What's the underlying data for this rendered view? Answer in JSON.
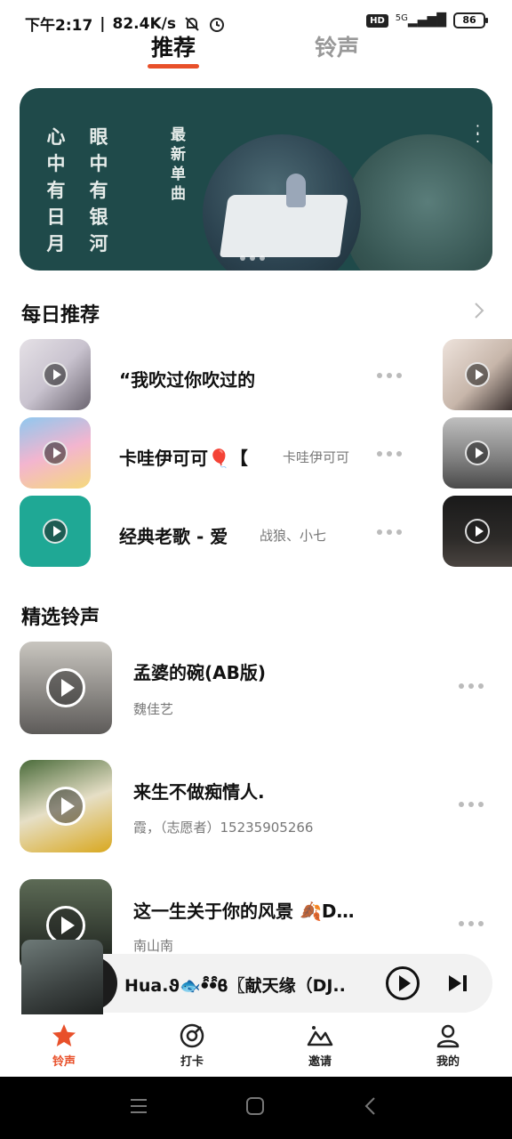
{
  "status_bar": {
    "time": "下午2:17",
    "speed": "82.4K/s",
    "network": "5G",
    "hd_badge": "HD",
    "battery": "86"
  },
  "top_tabs": [
    {
      "label": "推荐",
      "active": true
    },
    {
      "label": "铃声",
      "active": false
    }
  ],
  "banner": {
    "calligraphy_left": [
      "心",
      "中",
      "有",
      "日",
      "月"
    ],
    "calligraphy_right": [
      "眼",
      "中",
      "有",
      "银",
      "河"
    ],
    "vertical_text": [
      "最",
      "新",
      "单",
      "曲"
    ]
  },
  "daily": {
    "title": "每日推荐",
    "items": [
      {
        "title": "“我吹过你吹过的",
        "subtitle": ""
      },
      {
        "title": "卡哇伊可可🎈【",
        "subtitle": "卡哇伊可可"
      },
      {
        "title": "经典老歌 - 爱",
        "subtitle": "战狼、小七"
      }
    ]
  },
  "ringtones": {
    "title": "精选铃声",
    "items": [
      {
        "title": "孟婆的碗(AB版)",
        "artist": "魏佳艺"
      },
      {
        "title": "来生不做痴情人.",
        "artist": "霞，（志愿者）15235905266"
      },
      {
        "title": "这一生关于你的风景 🍂D…",
        "artist": "南山南"
      }
    ]
  },
  "player": {
    "title": "Hua.ϑ🐟ꔷ̑̑ꔷ̑̑ϐ〖献天缘（DJ.."
  },
  "bottom_nav": [
    {
      "label": "铃声",
      "icon": "star-icon",
      "active": true
    },
    {
      "label": "打卡",
      "icon": "checkin-icon",
      "active": false
    },
    {
      "label": "邀请",
      "icon": "invite-icon",
      "active": false
    },
    {
      "label": "我的",
      "icon": "profile-icon",
      "active": false
    }
  ],
  "colors": {
    "accent": "#e8502a",
    "banner_bg": "#1f4a4a"
  }
}
